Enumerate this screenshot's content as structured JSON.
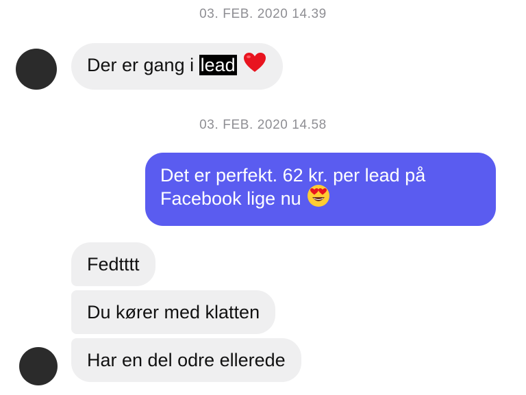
{
  "conversation": {
    "timestamps": [
      "03. FEB. 2020 14.39",
      "03. FEB. 2020 14.58"
    ],
    "messages": [
      {
        "sender": "contact",
        "prefix": "Der er gang i ",
        "highlight": "lead",
        "emoji": "heart-emoji"
      },
      {
        "sender": "me",
        "text": "Det er perfekt. 62 kr. per lead på Facebook lige nu",
        "emoji": "heart-eyes-emoji"
      },
      {
        "sender": "contact",
        "text": "Fedtttt"
      },
      {
        "sender": "contact",
        "text": "Du kører med klatten"
      },
      {
        "sender": "contact",
        "text": "Har en del odre ellerede"
      }
    ]
  },
  "colors": {
    "incoming_bubble": "#efeff0",
    "outgoing_bubble": "#5a5cf0",
    "timestamp_text": "#8e8e93",
    "avatar": "#2b2b2b",
    "heart": "#e8141f"
  }
}
